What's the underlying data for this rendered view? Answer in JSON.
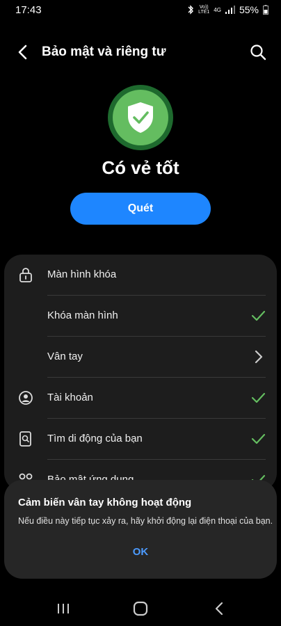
{
  "status_bar": {
    "time": "17:43",
    "volte_top": "Vo))",
    "volte_bottom": "LTE1",
    "network": "4G",
    "battery": "55%",
    "icons": [
      "bluetooth-icon",
      "signal-icon",
      "battery-icon"
    ]
  },
  "header": {
    "title": "Bảo mật và riêng tư",
    "back_icon": "back-arrow-icon",
    "search_icon": "search-icon"
  },
  "summary": {
    "status_text": "Có vẻ tốt",
    "scan_label": "Quét",
    "shield_color": "#64bd60"
  },
  "settings": {
    "items": [
      {
        "label": "Màn hình khóa",
        "icon": "lock-icon"
      },
      {
        "label": "Khóa màn hình",
        "status": "check-icon"
      },
      {
        "label": "Vân tay",
        "status": "chevron-right-icon"
      },
      {
        "label": "Tài khoản",
        "icon": "account-icon",
        "status": "check-icon"
      },
      {
        "label": "Tìm di động của bạn",
        "icon": "find-device-icon",
        "status": "check-icon"
      },
      {
        "label": "Bảo mật ứng dụng",
        "icon": "apps-icon",
        "status": "check-icon"
      }
    ]
  },
  "dialog": {
    "title": "Cảm biến vân tay không hoạt động",
    "message": "Nếu điều này tiếp tục xảy ra, hãy khởi động lại điện thoại của bạn.",
    "ok_label": "OK"
  },
  "nav_bar": {
    "icons": [
      "recents-icon",
      "home-icon",
      "back-icon"
    ]
  },
  "colors": {
    "accent": "#1e86ff",
    "check": "#64bd60",
    "dialog_link": "#4c9bff"
  }
}
